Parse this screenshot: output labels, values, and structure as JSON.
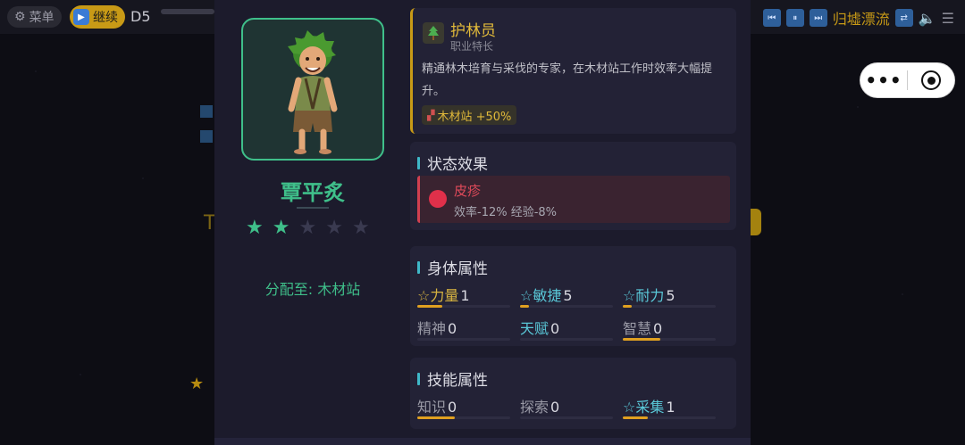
{
  "topbar": {
    "menu_label": "菜单",
    "continue_label": "继续",
    "day": "D5",
    "track_title": "归墟漂流",
    "controls": [
      "prev-icon",
      "pause-icon",
      "next-icon",
      "shuffle-icon",
      "volume-icon",
      "list-icon"
    ]
  },
  "background": {
    "faded_letter": "T"
  },
  "capsule": {
    "more": "•••"
  },
  "character": {
    "name": "覃平炙",
    "stars_total": 5,
    "stars_filled": 2,
    "star_glyph": "★",
    "assigned_prefix": "分配至:",
    "assigned_place": "木材站"
  },
  "profession": {
    "icon": "tree-icon",
    "title": "护林员",
    "subtitle": "职业特长",
    "description": "精通林木培育与采伐的专家，在木材站工作时效率大幅提升。",
    "bonus": "木材站 +50%"
  },
  "status": {
    "title": "状态效果",
    "effect_name": "皮疹",
    "effect_desc": "效率-12%  经验-8%"
  },
  "physical": {
    "title": "身体属性",
    "stats": [
      {
        "label": "☆力量",
        "value": "1",
        "color": "gold",
        "fill": 0.27
      },
      {
        "label": "☆敏捷",
        "value": "5",
        "color": "cyan",
        "fill": 0.1
      },
      {
        "label": "☆耐力",
        "value": "5",
        "color": "cyan",
        "fill": 0.1
      },
      {
        "label": "精神",
        "value": "0",
        "color": "gray",
        "fill": 0
      },
      {
        "label": "天赋",
        "value": "0",
        "color": "cyan",
        "fill": 0
      },
      {
        "label": "智慧",
        "value": "0",
        "color": "gray",
        "fill": 0.4
      }
    ]
  },
  "skills": {
    "title": "技能属性",
    "stats": [
      {
        "label": "知识",
        "value": "0",
        "color": "gray",
        "fill": 0.4
      },
      {
        "label": "探索",
        "value": "0",
        "color": "gray",
        "fill": 0
      },
      {
        "label": "☆采集",
        "value": "1",
        "color": "cyan",
        "fill": 0.27
      }
    ]
  },
  "colors": {
    "accent_green": "#3fbf8a",
    "accent_gold": "#e0b93a",
    "accent_cyan": "#5ac8d8",
    "danger": "#e0304a",
    "modal_bg": "#1c1b2c"
  }
}
